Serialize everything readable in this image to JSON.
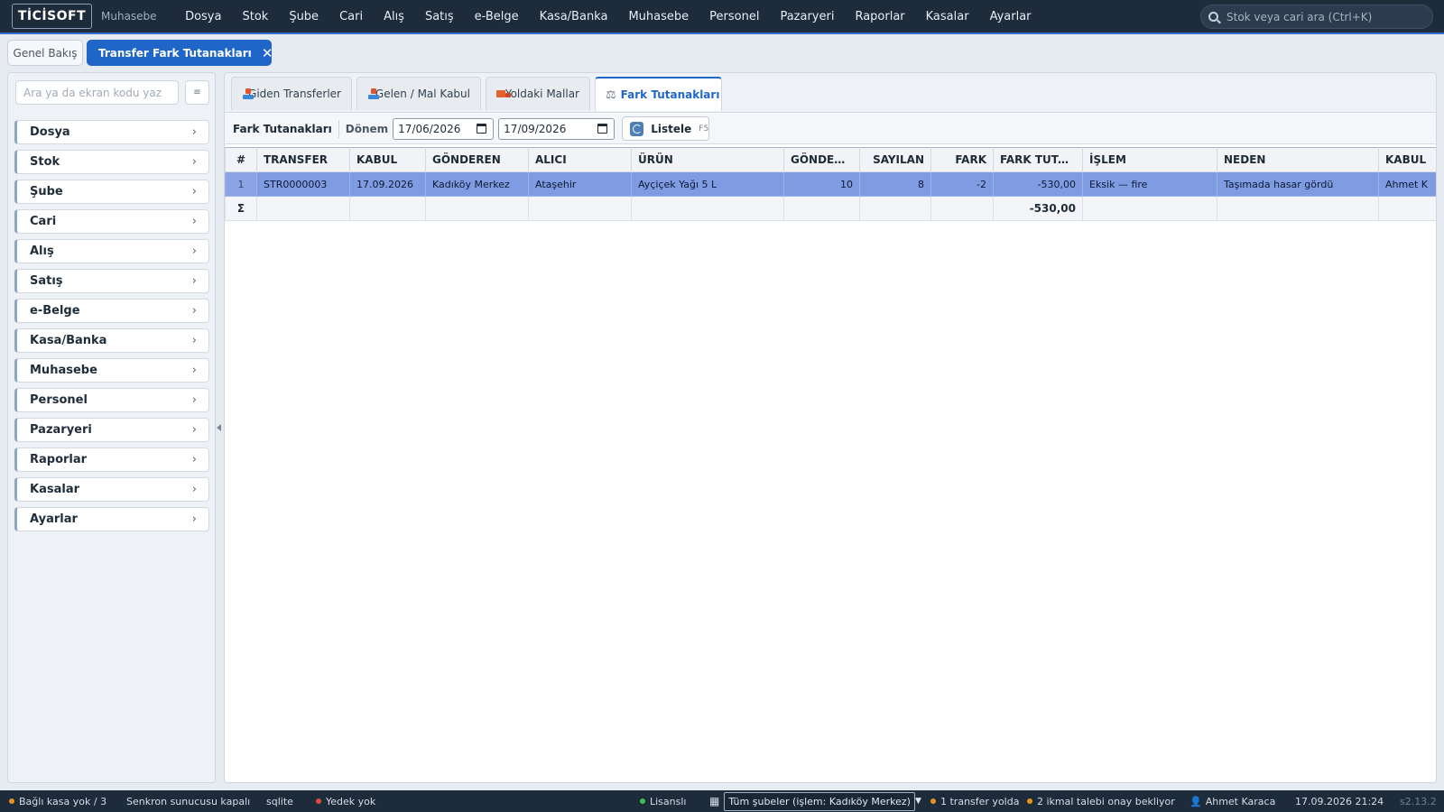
{
  "topbar": {
    "logo": "TİCİSOFT",
    "subtitle": "Muhasebe",
    "menu": [
      "Dosya",
      "Stok",
      "Şube",
      "Cari",
      "Alış",
      "Satış",
      "e-Belge",
      "Kasa/Banka",
      "Muhasebe",
      "Personel",
      "Pazaryeri",
      "Raporlar",
      "Kasalar",
      "Ayarlar"
    ],
    "search_placeholder": "Stok veya cari ara (Ctrl+K)"
  },
  "doc_tabs": {
    "overview": "Genel Bakış",
    "active": "Transfer Fark Tutanakları",
    "close": "✕"
  },
  "sidebar": {
    "search_placeholder": "Ara ya da ekran kodu yaz",
    "toggle_glyph": "≡",
    "items": [
      "Dosya",
      "Stok",
      "Şube",
      "Cari",
      "Alış",
      "Satış",
      "e-Belge",
      "Kasa/Banka",
      "Muhasebe",
      "Personel",
      "Pazaryeri",
      "Raporlar",
      "Kasalar",
      "Ayarlar"
    ],
    "chevron": "›"
  },
  "tabs": [
    {
      "label": "Giden Transferler",
      "icon": "upload-box-icon"
    },
    {
      "label": "Gelen / Mal Kabul",
      "icon": "download-box-icon"
    },
    {
      "label": "Yoldaki Mallar",
      "icon": "truck-icon"
    },
    {
      "label": "Fark Tutanakları",
      "icon": "scale-icon",
      "active": true
    }
  ],
  "toolbar": {
    "title": "Fark Tutanakları",
    "period_label": "Dönem",
    "date_from": "17/06/2026",
    "date_to": "17/09/2026",
    "list_button": "Listele",
    "list_shortcut": "F5"
  },
  "table": {
    "columns": [
      "#",
      "TRANSFER",
      "KABUL",
      "GÖNDEREN",
      "ALICI",
      "ÜRÜN",
      "GÖNDERİ...",
      "SAYILAN",
      "FARK",
      "FARK TUTARI",
      "İŞLEM",
      "NEDEN",
      "KABUL"
    ],
    "rows": [
      [
        "1",
        "STR0000003",
        "17.09.2026",
        "Kadıköy Merkez",
        "Ataşehir",
        "Ayçiçek Yağı 5 L",
        "10",
        "8",
        "-2",
        "-530,00",
        "Eksik — fire",
        "Taşımada hasar gördü",
        "Ahmet K"
      ]
    ],
    "sum_symbol": "Σ",
    "sum_total": "-530,00"
  },
  "status": {
    "cash_registers": "Bağlı kasa yok / 3",
    "sync": "Senkron sunucusu kapalı",
    "db": "sqlite",
    "backup": "Yedek yok",
    "license": "Lisanslı",
    "branch_select": "Tüm şubeler (işlem: Kadıköy Merkez)",
    "transfers": "1 transfer yolda",
    "requests": "2 ikmal talebi onay bekliyor",
    "user": "Ahmet Karaca",
    "datetime": "17.09.2026 21:24",
    "version": "s2.13.2"
  },
  "colors": {
    "topbar_bg": "#1e2b3a",
    "accent": "#1f66c8",
    "selected_row": "#7f9ce3",
    "status_orange": "#e8931e",
    "status_red": "#e04848",
    "status_green": "#3fbf5a"
  }
}
